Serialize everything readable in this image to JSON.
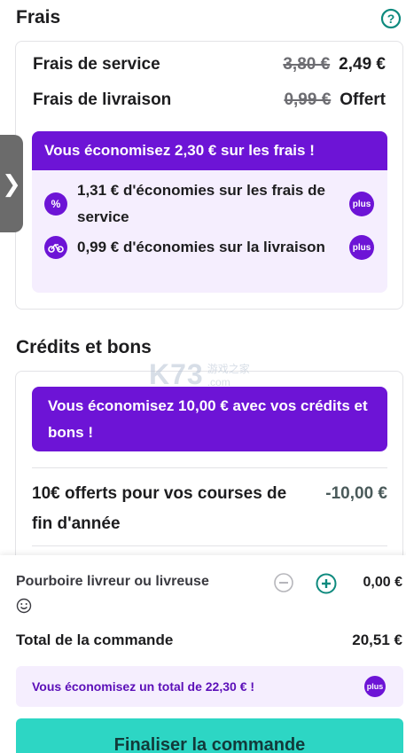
{
  "fees": {
    "title": "Frais",
    "rows": [
      {
        "label": "Frais de service",
        "old": "3,80 €",
        "new": "2,49 €"
      },
      {
        "label": "Frais de livraison",
        "old": "0,99 €",
        "new": "Offert"
      }
    ],
    "savings_header": "Vous économisez 2,30 € sur les frais !",
    "savings_items": [
      {
        "text": "1,31 € d'économies sur les frais de service",
        "icon": "percent-icon",
        "badge": "plus"
      },
      {
        "text": "0,99 € d'économies sur la livraison",
        "icon": "bicycle-icon",
        "badge": "plus"
      }
    ]
  },
  "credits": {
    "title": "Crédits et bons",
    "banner": "Vous économisez 10,00 € avec vos crédits et bons !",
    "voucher_label": "10€ offerts pour vos courses de fin d'année",
    "voucher_amount": "-10,00 €"
  },
  "footer": {
    "tip_label": "Pourboire livreur ou livreuse",
    "tip_value": "0,00 €",
    "total_label": "Total de la commande",
    "total_value": "20,51 €",
    "total_savings": "Vous économisez un total de 22,30 € !",
    "total_savings_badge": "plus",
    "checkout_label": "Finaliser la commande"
  },
  "side_tab": {
    "glyph": "❯"
  },
  "watermark": {
    "text": "K73",
    "sub": "游戏之家",
    "domain": ".com"
  },
  "colors": {
    "accent": "#6d14d6",
    "teal": "#2dd6c4",
    "help": "#0e8a7e"
  }
}
